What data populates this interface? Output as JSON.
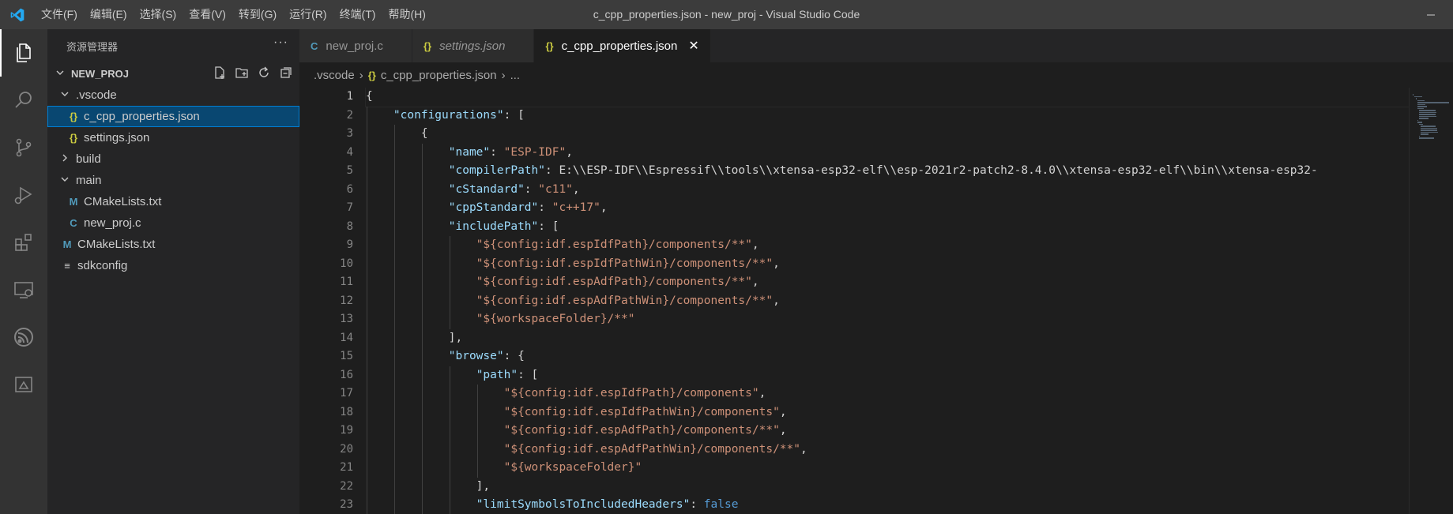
{
  "titlebar": {
    "title": "c_cpp_properties.json - new_proj - Visual Studio Code",
    "menu": [
      "文件(F)",
      "编辑(E)",
      "选择(S)",
      "查看(V)",
      "转到(G)",
      "运行(R)",
      "终端(T)",
      "帮助(H)"
    ]
  },
  "activity": [
    "explorer-icon",
    "search-icon",
    "source-control-icon",
    "run-debug-icon",
    "extensions-icon",
    "remote-explorer-icon",
    "espressif-icon",
    "idf-app-icon"
  ],
  "sidebar": {
    "header": "资源管理器",
    "more": "···",
    "project": "NEW_PROJ",
    "tree": [
      {
        "label": ".vscode",
        "type": "folder-open",
        "indent": 1
      },
      {
        "label": "c_cpp_properties.json",
        "type": "json",
        "indent": 2,
        "selected": true
      },
      {
        "label": "settings.json",
        "type": "json",
        "indent": 2
      },
      {
        "label": "build",
        "type": "folder",
        "indent": 1
      },
      {
        "label": "main",
        "type": "folder-open",
        "indent": 1
      },
      {
        "label": "CMakeLists.txt",
        "type": "cmake",
        "indent": 2
      },
      {
        "label": "new_proj.c",
        "type": "c",
        "indent": 2
      },
      {
        "label": "CMakeLists.txt",
        "type": "cmake",
        "indent": 1
      },
      {
        "label": "sdkconfig",
        "type": "file",
        "indent": 1
      }
    ]
  },
  "tabs": [
    {
      "label": "new_proj.c",
      "icon": "C",
      "active": false,
      "italic": false
    },
    {
      "label": "settings.json",
      "icon": "{}",
      "active": false,
      "italic": true
    },
    {
      "label": "c_cpp_properties.json",
      "icon": "{}",
      "active": true,
      "italic": false
    }
  ],
  "tab_close": "✕",
  "breadcrumb": {
    "folder": ".vscode",
    "file": "c_cpp_properties.json",
    "tail": "..."
  },
  "editor": {
    "lines": [
      "{",
      "    \"configurations\": [",
      "        {",
      "            \"name\": \"ESP-IDF\",",
      "            \"compilerPath\": \"E:\\\\ESP-IDF\\\\Espressif\\\\tools\\\\xtensa-esp32-elf\\\\esp-2021r2-patch2-8.4.0\\\\xtensa-esp32-elf\\\\bin\\\\xtensa-esp32-",
      "            \"cStandard\": \"c11\",",
      "            \"cppStandard\": \"c++17\",",
      "            \"includePath\": [",
      "                \"${config:idf.espIdfPath}/components/**\",",
      "                \"${config:idf.espIdfPathWin}/components/**\",",
      "                \"${config:idf.espAdfPath}/components/**\",",
      "                \"${config:idf.espAdfPathWin}/components/**\",",
      "                \"${workspaceFolder}/**\"",
      "            ],",
      "            \"browse\": {",
      "                \"path\": [",
      "                    \"${config:idf.espIdfPath}/components\",",
      "                    \"${config:idf.espIdfPathWin}/components\",",
      "                    \"${config:idf.espAdfPath}/components/**\",",
      "                    \"${config:idf.espAdfPathWin}/components/**\",",
      "                    \"${workspaceFolder}\"",
      "                ],",
      "                \"limitSymbolsToIncludedHeaders\": false"
    ],
    "current_line": 1
  },
  "colors": {
    "key": "#9cdcfe",
    "string": "#ce9178",
    "keyword": "#569cd6",
    "json_icon": "#cbcb41",
    "c_icon": "#519aba",
    "cmake_icon": "#519aba",
    "vscode_blue": "#23a9f2"
  }
}
